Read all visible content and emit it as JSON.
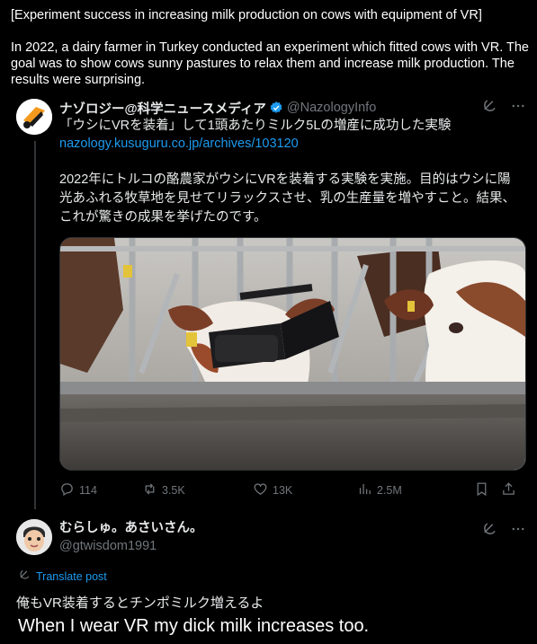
{
  "intro": {
    "title": "[Experiment success in increasing milk production on cows with equipment of VR]",
    "description": "In 2022, a dairy farmer in Turkey conducted an experiment which fitted cows with VR. The goal was to show cows sunny pastures to relax them and increase milk production. The results were surprising."
  },
  "post": {
    "author_name": "ナゾロジー@科学ニュースメディア",
    "handle": "@NazologyInfo",
    "headline": "「ウシにVRを装着」して1頭あたりミルク5Lの増産に成功した実験",
    "link": "nazology.kusuguru.co.jp/archives/103120",
    "body": "2022年にトルコの酪農家がウシにVRを装着する実験を実施。目的はウシに陽光あふれる牧草地を見せてリラックスさせ、乳の生産量を増やすこと。結果、これが驚きの成果を挙げたのです。",
    "stats": {
      "replies": "114",
      "reposts": "3.5K",
      "likes": "13K",
      "views": "2.5M"
    }
  },
  "reply": {
    "author_name": "むらしゅ。あさいさん。",
    "handle": "@gtwisdom1991",
    "translate_label": "Translate post",
    "text": "俺もVR装着するとチンポミルク増えるよ"
  },
  "caption": "When I wear VR my dick milk increases too.",
  "colors": {
    "background": "#000000",
    "link": "#1d9bf0",
    "muted": "#71767b",
    "verified": "#1d9bf0"
  },
  "icons": [
    "verified-badge-icon",
    "grok-icon",
    "more-icon",
    "reply-icon",
    "repost-icon",
    "like-icon",
    "views-icon",
    "bookmark-icon",
    "share-icon",
    "translate-icon"
  ]
}
